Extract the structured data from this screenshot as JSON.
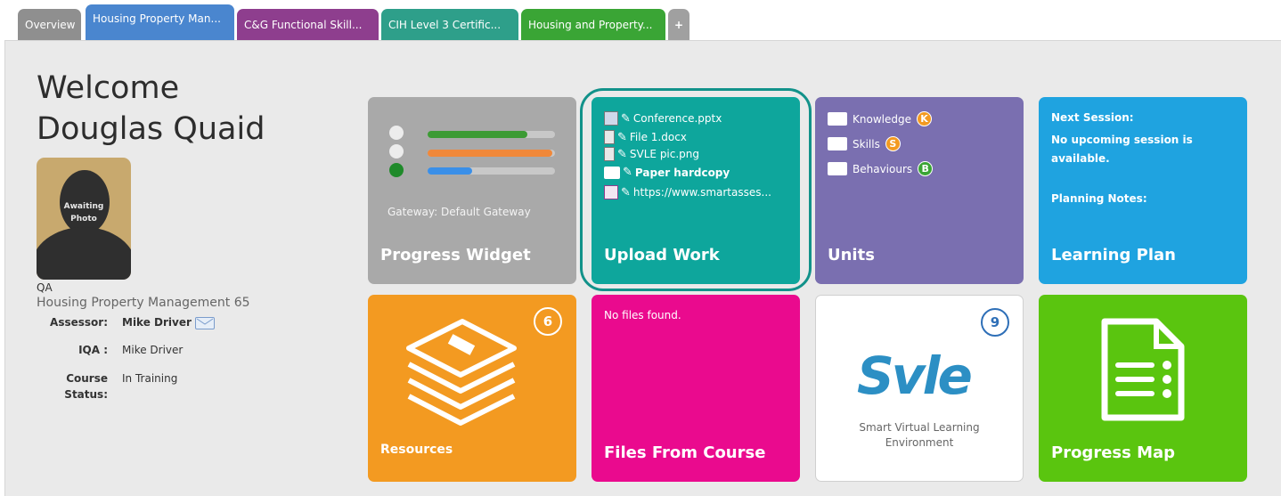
{
  "tabs": [
    {
      "label": "Overview",
      "color": "#8f8f8f"
    },
    {
      "label": "Housing Property Man...",
      "color": "#4a86cf"
    },
    {
      "label": "C&G Functional Skill...",
      "color": "#8e3e8e"
    },
    {
      "label": "CIH Level 3 Certific...",
      "color": "#2e9f8a"
    },
    {
      "label": "Housing and Property...",
      "color": "#3aa535"
    },
    {
      "label": "+",
      "color": "#a0a0a0"
    }
  ],
  "profile": {
    "welcome": "Welcome",
    "name": "Douglas Quaid",
    "photo_caption_1": "Awaiting",
    "photo_caption_2": "Photo",
    "role": "QA",
    "course": "Housing Property Management 65",
    "assessor_label": "Assessor:",
    "assessor_value": "Mike Driver",
    "iqa_label": "IQA :",
    "iqa_value": "Mike Driver",
    "status_label_1": "Course",
    "status_label_2": "Status:",
    "status_value": "In Training"
  },
  "tiles": {
    "progress": {
      "title": "Progress Widget",
      "gateway": "Gateway: Default Gateway",
      "bars": [
        0.78,
        0.98,
        0.35
      ],
      "color": "#a9a9a9"
    },
    "upload": {
      "title": "Upload Work",
      "color": "#0ea69c",
      "files": [
        "Conference.pptx",
        "File 1.docx",
        "SVLE pic.png",
        "Paper hardcopy",
        "https://www.smartasses..."
      ]
    },
    "units": {
      "title": "Units",
      "color": "#7a6fb0",
      "items": [
        {
          "label": "Knowledge",
          "badge": "K"
        },
        {
          "label": "Skills",
          "badge": "S"
        },
        {
          "label": "Behaviours",
          "badge": "B"
        }
      ]
    },
    "plan": {
      "title": "Learning Plan",
      "color": "#1fa3e0",
      "next_label": "Next Session:",
      "next_value_1": "No upcoming session is",
      "next_value_2": "available.",
      "notes_label": "Planning Notes:"
    },
    "resources": {
      "title": "Resources",
      "count": "6",
      "color": "#f39a21"
    },
    "files_course": {
      "title": "Files From Course",
      "empty": "No files found.",
      "color": "#ea0a8e"
    },
    "svle": {
      "count": "9",
      "logo_text": "Svle",
      "sub_1": "Smart Virtual Learning",
      "sub_2": "Environment"
    },
    "map": {
      "title": "Progress Map",
      "color": "#5ac50f"
    }
  },
  "colors": {
    "highlight_ring": "#12928a",
    "bar_green": "#3d9b35",
    "bar_orange": "#f0883a",
    "bar_blue": "#3a8fe8"
  }
}
